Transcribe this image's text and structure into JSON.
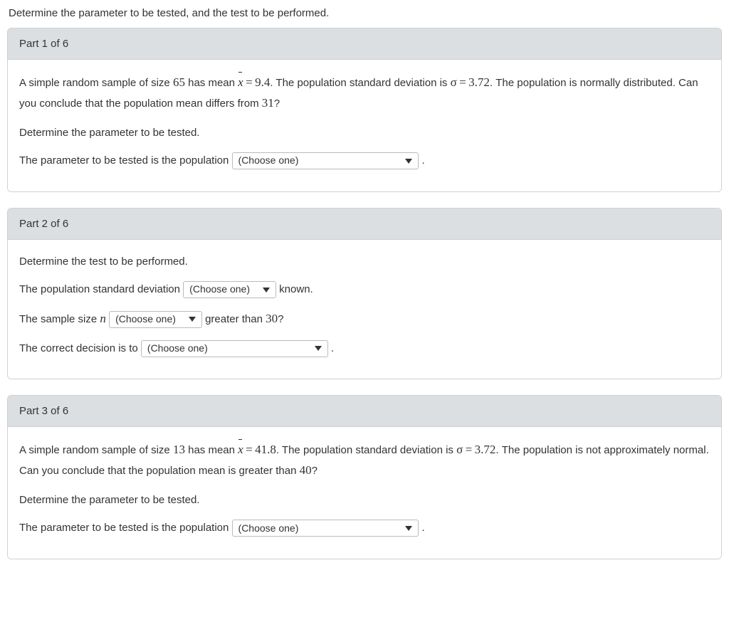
{
  "instruction": "Determine the parameter to be tested, and the test to be performed.",
  "dropdown_placeholder": "(Choose one)",
  "parts": {
    "p1": {
      "header": "Part 1 of 6",
      "problem_a": "A simple random sample of size ",
      "n": "65",
      "problem_b": " has mean ",
      "xbar_eq": " = 9.4",
      "problem_c": ". The population standard deviation is ",
      "sigma_eq": "σ = 3.72",
      "problem_d": ". The population is normally distributed. Can you conclude that the population mean differs from ",
      "target": "31",
      "qmark": "?",
      "prompt": "Determine the parameter to be tested.",
      "answer_lead": "The parameter to be tested is the population ",
      "period": "."
    },
    "p2": {
      "header": "Part 2 of 6",
      "prompt": "Determine the test to be performed.",
      "l1a": "The population standard deviation ",
      "l1b": " known.",
      "l2a": "The sample size ",
      "l2b": " greater than ",
      "l2n": "30",
      "qmark": "?",
      "l3a": "The correct decision is to ",
      "period": "."
    },
    "p3": {
      "header": "Part 3 of 6",
      "problem_a": "A simple random sample of size ",
      "n": "13",
      "problem_b": " has mean ",
      "xbar_eq": " = 41.8",
      "problem_c": ". The population standard deviation is ",
      "sigma_eq": "σ = 3.72",
      "problem_d": ". The population is not approximately normal. Can you conclude that the population mean is greater than ",
      "target": "40",
      "qmark": "?",
      "prompt": "Determine the parameter to be tested.",
      "answer_lead": "The parameter to be tested is the population ",
      "period": "."
    }
  }
}
